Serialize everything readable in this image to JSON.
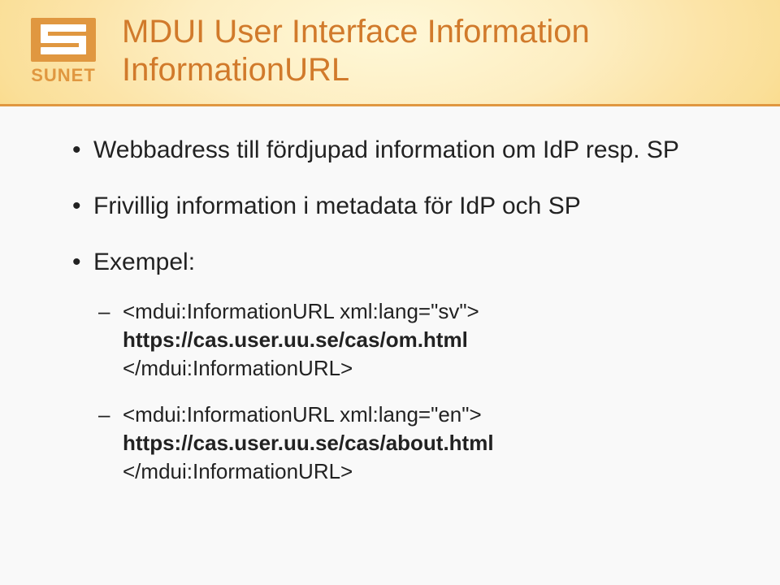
{
  "logo": {
    "name": "SUNET"
  },
  "title": {
    "line1": "MDUI User Interface Information",
    "line2": "InformationURL"
  },
  "bullets": {
    "b1": "Webbadress till fördjupad information om IdP resp. SP",
    "b2": "Frivillig information i metadata för IdP och SP",
    "b3": "Exempel:",
    "ex1": {
      "open": "<mdui:InformationURL xml:lang=\"sv\">",
      "url": "https://cas.user.uu.se/cas/om.html",
      "close": "</mdui:InformationURL>"
    },
    "ex2": {
      "open": "<mdui:InformationURL xml:lang=\"en\">",
      "url": "https://cas.user.uu.se/cas/about.html",
      "close": "</mdui:InformationURL>"
    }
  }
}
